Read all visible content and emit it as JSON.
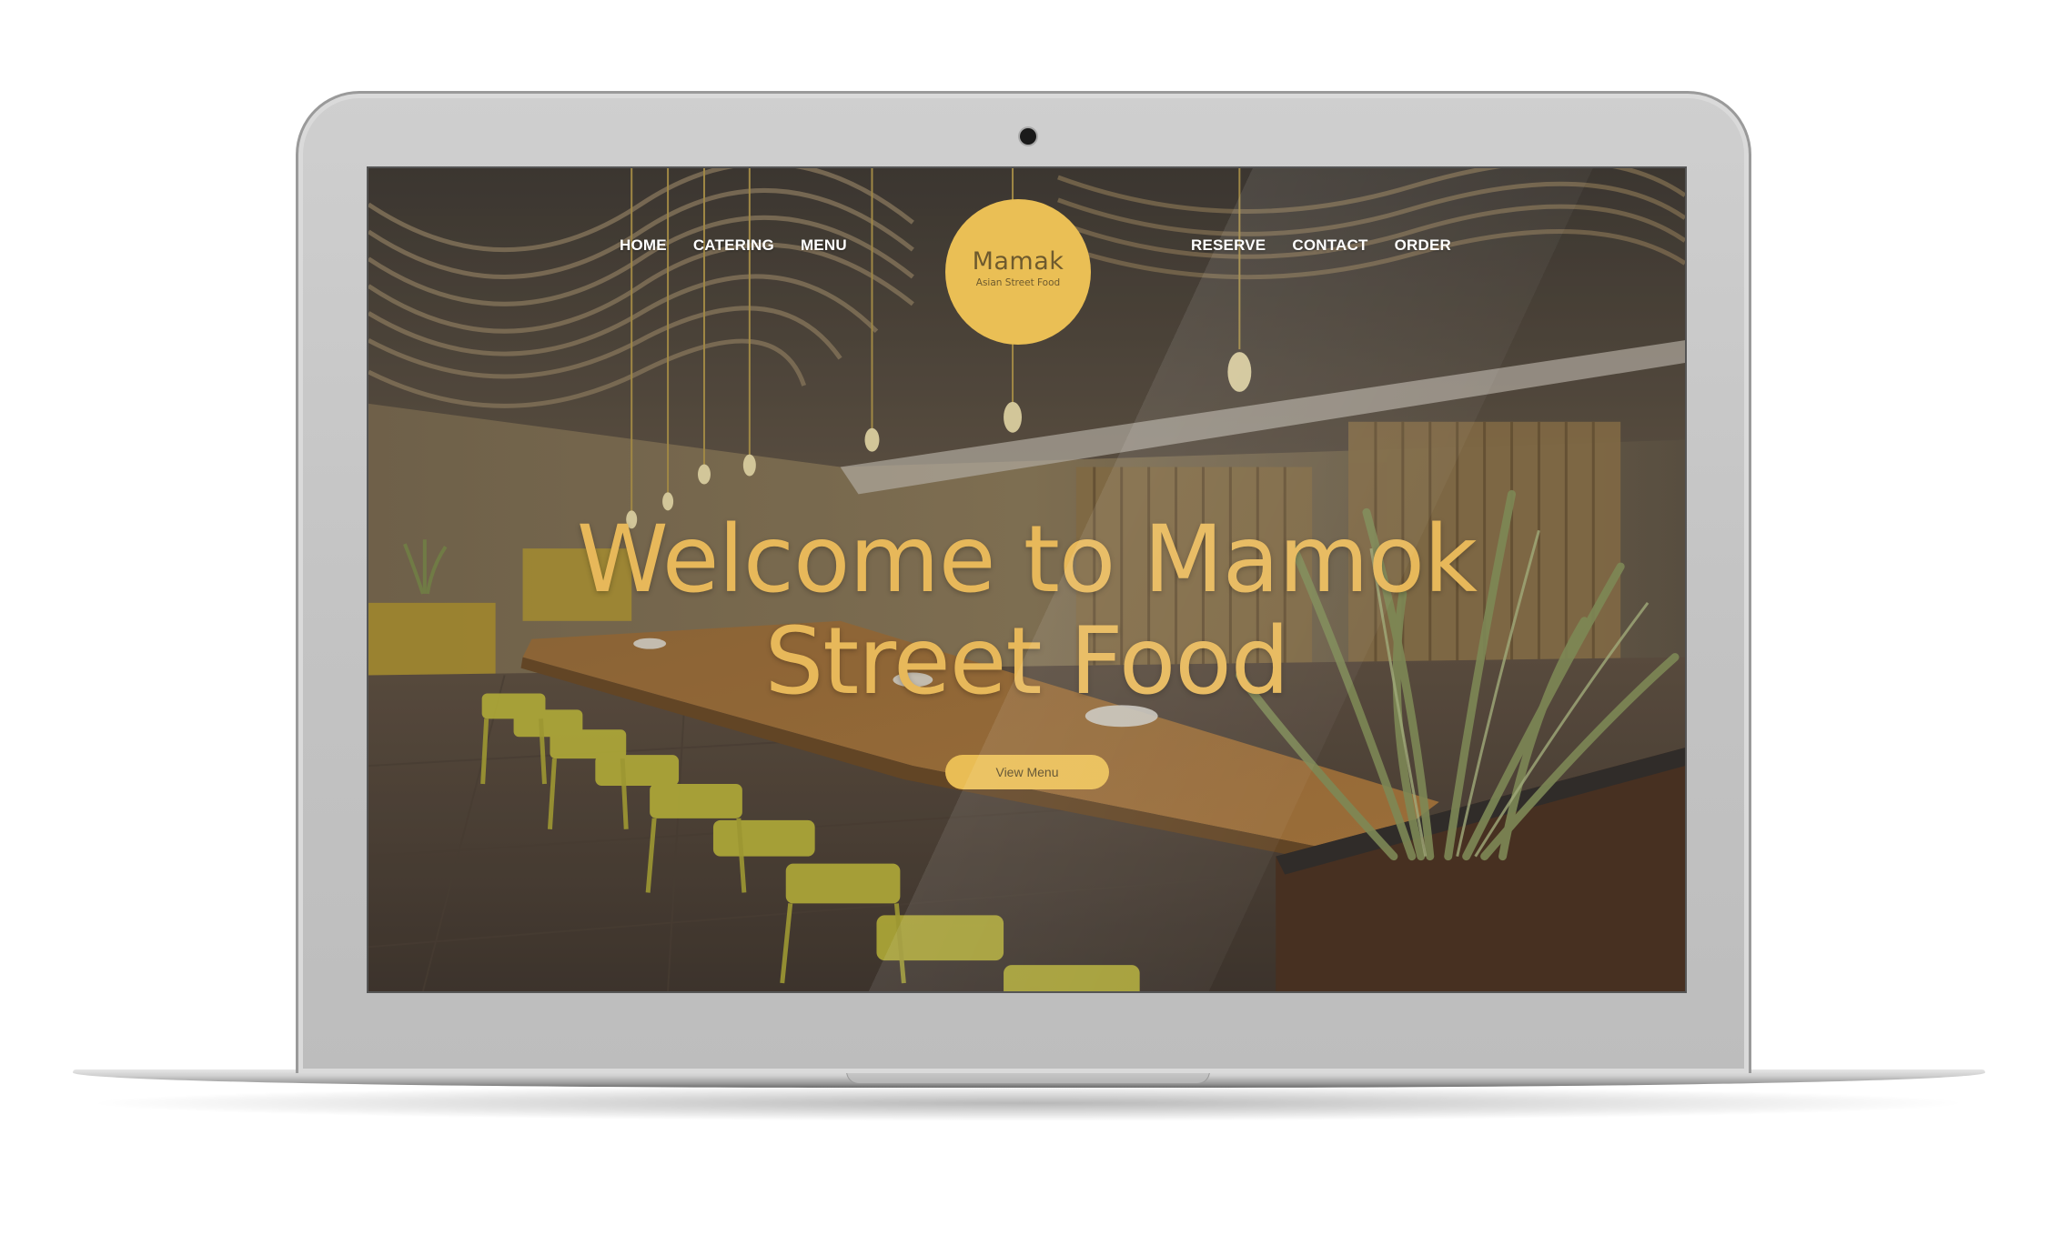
{
  "site": {
    "nav_left": [
      {
        "label": "HOME"
      },
      {
        "label": "CATERING"
      },
      {
        "label": "MENU"
      }
    ],
    "nav_right": [
      {
        "label": "RESERVE"
      },
      {
        "label": "CONTACT"
      },
      {
        "label": "ORDER"
      }
    ],
    "logo": {
      "name": "Mamak",
      "tagline": "Asian Street Food"
    },
    "hero": {
      "headline_line1": "Welcome to Mamok",
      "headline_line2": "Street Food",
      "cta_label": "View Menu"
    }
  },
  "colors": {
    "brand_yellow": "#eabf55",
    "headline_yellow": "#e7b85a",
    "laptop_silver": "#c6c6c6"
  }
}
